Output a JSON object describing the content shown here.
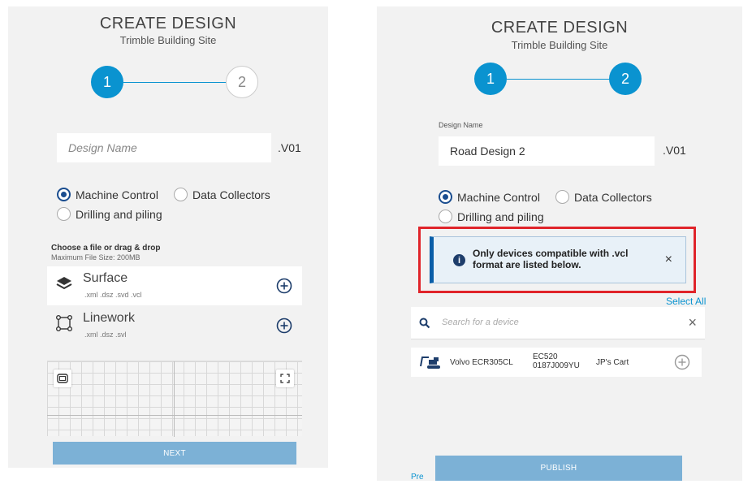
{
  "left": {
    "title": "CREATE DESIGN",
    "subtitle": "Trimble Building Site",
    "step1": "1",
    "step2": "2",
    "design_name_placeholder": "Design Name",
    "version_suffix": ".V01",
    "radios": {
      "machine_control": "Machine Control",
      "data_collectors": "Data Collectors",
      "drilling": "Drilling and piling",
      "selected": "machine_control"
    },
    "choose_file": "Choose a file or drag & drop",
    "max_file_size": "Maximum File Size: 200MB",
    "files": [
      {
        "name": "Surface",
        "ext": ".xml .dsz .svd .vcl",
        "icon": "layers-icon"
      },
      {
        "name": "Linework",
        "ext": ".xml .dsz .svl",
        "icon": "linework-icon"
      }
    ],
    "next_label": "NEXT"
  },
  "right": {
    "title": "CREATE DESIGN",
    "subtitle": "Trimble Building Site",
    "step1": "1",
    "step2": "2",
    "design_name_label": "Design Name",
    "design_name_value": "Road Design 2",
    "version_suffix": ".V01",
    "radios": {
      "machine_control": "Machine Control",
      "data_collectors": "Data Collectors",
      "drilling": "Drilling and piling",
      "selected": "machine_control"
    },
    "alert": {
      "line1": "Only devices compatible with .vcl",
      "line2": "format are listed below.",
      "close": "×"
    },
    "select_all": "Select All",
    "search_placeholder": "Search for a device",
    "search_clear": "×",
    "device": {
      "name": "Volvo ECR305CL",
      "model": "EC520",
      "serial": "0187J009YU",
      "owner": "JP's Cart",
      "icon": "excavator-icon"
    },
    "publish_label": "PUBLISH",
    "bottom_link": "Pre"
  },
  "colors": {
    "accent": "#0a93d0",
    "button": "#7cb1d6",
    "alert_outline": "#e0242a",
    "radio": "#1a4d8f"
  }
}
